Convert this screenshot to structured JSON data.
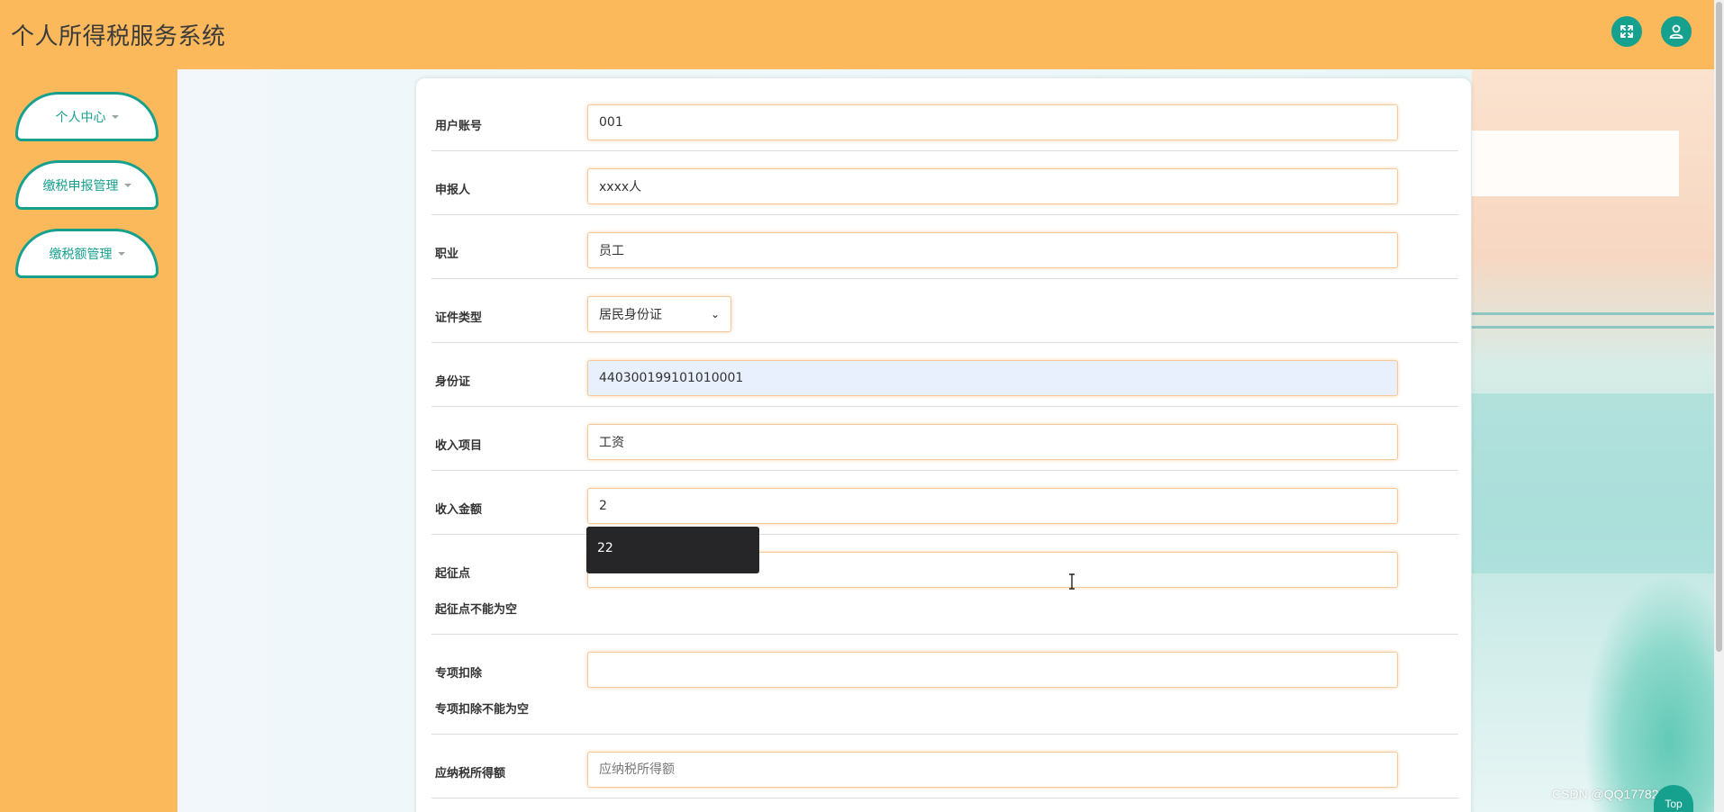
{
  "header": {
    "title": "个人所得税服务系统",
    "fullscreen_icon": "expand-icon",
    "user_icon": "user-icon"
  },
  "sidebar": {
    "items": [
      {
        "label": "个人中心"
      },
      {
        "label": "缴税申报管理"
      },
      {
        "label": "缴税额管理"
      }
    ]
  },
  "form": {
    "account": {
      "label": "用户账号",
      "value": "001"
    },
    "applicant": {
      "label": "申报人",
      "value": "xxxx人"
    },
    "occupation": {
      "label": "职业",
      "value": "员工"
    },
    "id_type": {
      "label": "证件类型",
      "value": "居民身份证"
    },
    "id_number": {
      "label": "身份证",
      "value": "440300199101010001"
    },
    "income_item": {
      "label": "收入项目",
      "value": "工资"
    },
    "income_amount": {
      "label": "收入金额",
      "value": "2"
    },
    "threshold": {
      "label": "起征点",
      "value": "",
      "error": "起征点不能为空"
    },
    "special_deduction": {
      "label": "专项扣除",
      "value": "",
      "error": "专项扣除不能为空"
    },
    "taxable_income": {
      "label": "应纳税所得额",
      "value": "",
      "placeholder": "应纳税所得额"
    }
  },
  "autocomplete": {
    "suggestion": "22"
  },
  "watermark": "CSDN @QQ177825331",
  "top_button": "Top",
  "colors": {
    "accent": "#16a08e",
    "header_bg": "#fbb95c",
    "input_border": "#f4c89a"
  }
}
